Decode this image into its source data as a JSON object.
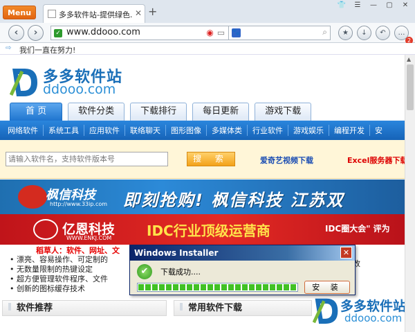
{
  "browser": {
    "menu_label": "Menu",
    "tab_title": "多多软件站-提供绿色...",
    "tab_close": "✕",
    "new_tab": "+",
    "window_controls": [
      "👕",
      "☰",
      "—",
      "▢",
      "✕"
    ],
    "url": "www.ddooo.com",
    "notification_count": "2"
  },
  "infobar": {
    "text": "我们一直在努力!"
  },
  "site": {
    "logo_cn": "多多软件站",
    "logo_en": "ddooo.com",
    "main_tabs": [
      "首 页",
      "软件分类",
      "下载排行",
      "每日更新",
      "游戏下载"
    ],
    "categories": [
      "网络软件",
      "系统工具",
      "应用软件",
      "联络聊天",
      "图形图像",
      "多媒体类",
      "行业软件",
      "游戏娱乐",
      "编程开发",
      "安"
    ],
    "search_placeholder": "请输入软件名，支持软件版本号",
    "search_button": "搜 索",
    "promo1": "爱奇艺视频下载",
    "promo2": "Excel服务器下载"
  },
  "banner1": {
    "name": "枫信科技",
    "url": "http://www.33ip.com",
    "slogan": "即刻抢购! 枫信科技 江苏双"
  },
  "banner2": {
    "name": "亿恩科技",
    "url": "WWW.ENKJ.COM",
    "slogan": "IDC行业顶级运营商",
    "right": "IDC圈大会\" 评为"
  },
  "features": {
    "title": "稻草人：软件、网址、文",
    "items": [
      "• 漂亮、容易操作、可定制的",
      "• 无数量限制的热键设定",
      "• 超方便管理软件程序、文件",
      "• 创新的图标缓存技术"
    ],
    "right_fragment": "改"
  },
  "sections": {
    "left": "软件推荐",
    "right": "常用软件下载"
  },
  "watermark": {
    "cn": "多多软件站",
    "en": "ddooo.com"
  },
  "dialog": {
    "title": "Windows Installer",
    "close": "✕",
    "message": "下载成功....",
    "progress": 1.0,
    "install_button": "安 装"
  },
  "colors": {
    "brand_blue": "#1a6fb8",
    "accent_orange": "#e26410",
    "success_green": "#41c125"
  }
}
